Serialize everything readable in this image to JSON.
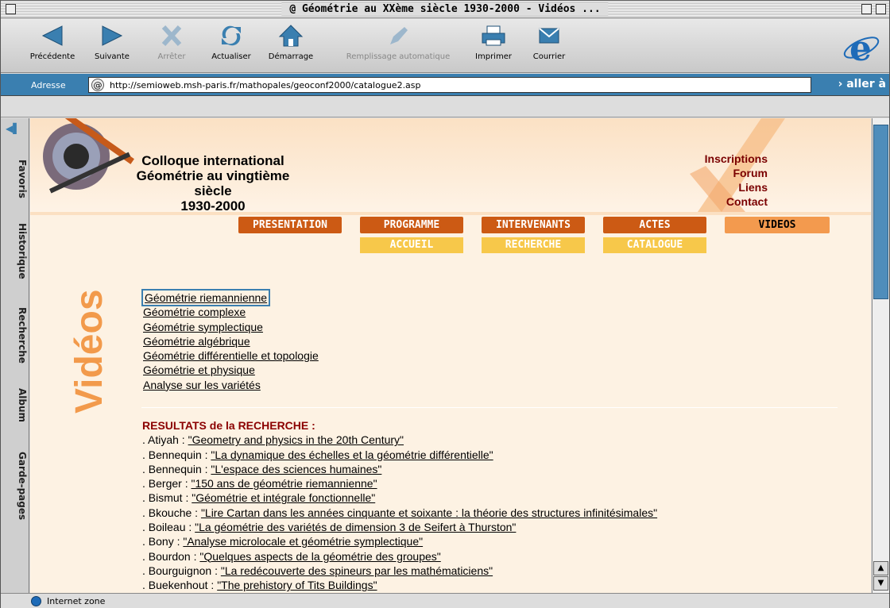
{
  "window": {
    "title": "@ Géométrie au XXème siècle 1930-2000 - Vidéos ..."
  },
  "toolbar": {
    "back": "Précédente",
    "forward": "Suivante",
    "stop": "Arrêter",
    "refresh": "Actualiser",
    "home": "Démarrage",
    "autofill": "Remplissage automatique",
    "print": "Imprimer",
    "mail": "Courrier"
  },
  "address": {
    "label": "Adresse",
    "url": "http://semioweb.msh-paris.fr/mathopales/geoconf2000/catalogue2.asp",
    "go": "aller à"
  },
  "sidebar_tabs": [
    "Favoris",
    "Historique",
    "Recherche",
    "Album",
    "Garde-pages"
  ],
  "banner": {
    "line1": "Colloque international",
    "line2": "Géométrie au vingtième siècle",
    "line3": "1930-2000",
    "links": [
      "Inscriptions",
      "Forum",
      "Liens",
      "Contact"
    ]
  },
  "nav": {
    "tabs": [
      "PRESENTATION",
      "PROGRAMME",
      "INTERVENANTS",
      "ACTES",
      "VIDEOS"
    ],
    "subtabs": [
      "ACCUEIL",
      "RECHERCHE",
      "CATALOGUE"
    ]
  },
  "page": {
    "vertical_title": "Vidéos",
    "categories": [
      "Géométrie riemannienne",
      "Géométrie complexe",
      "Géométrie symplectique",
      "Géométrie algébrique",
      "Géométrie différentielle et topologie",
      "Géométrie et physique",
      "Analyse sur les variétés"
    ],
    "results_title": "RESULTATS de la RECHERCHE :",
    "results": [
      {
        "author": ". Atiyah : ",
        "title": "\"Geometry and physics in the 20th Century\""
      },
      {
        "author": ". Bennequin : ",
        "title": "\"La dynamique des échelles et la géométrie différentielle\""
      },
      {
        "author": ". Bennequin : ",
        "title": "\"L'espace des sciences humaines\""
      },
      {
        "author": ". Berger : ",
        "title": "\"150 ans de géométrie riemannienne\""
      },
      {
        "author": ". Bismut : ",
        "title": "\"Géométrie et intégrale fonctionnelle\""
      },
      {
        "author": ". Bkouche : ",
        "title": "\"Lire Cartan dans les années cinquante et soixante : la théorie des structures infinitésimales\""
      },
      {
        "author": ". Boileau : ",
        "title": "\"La géométrie des variétés de dimension 3 de Seifert à Thurston\""
      },
      {
        "author": ". Bony : ",
        "title": "\"Analyse microlocale et géométrie symplectique\""
      },
      {
        "author": ". Bourdon : ",
        "title": "\"Quelques aspects de la géométrie des groupes\""
      },
      {
        "author": ". Bourguignon : ",
        "title": "\"La redécouverte des spineurs par les mathématiciens\""
      },
      {
        "author": ". Buekenhout : ",
        "title": "\"The prehistory of Tits Buildings\""
      }
    ]
  },
  "status": {
    "zone": "Internet zone"
  },
  "colors": {
    "accent": "#3a7fb0",
    "nav": "#cc5a14",
    "nav_active": "#f39a4e",
    "subnav": "#f7c84a",
    "results_title": "#8b0000",
    "vertical_title": "#f29a4b"
  }
}
